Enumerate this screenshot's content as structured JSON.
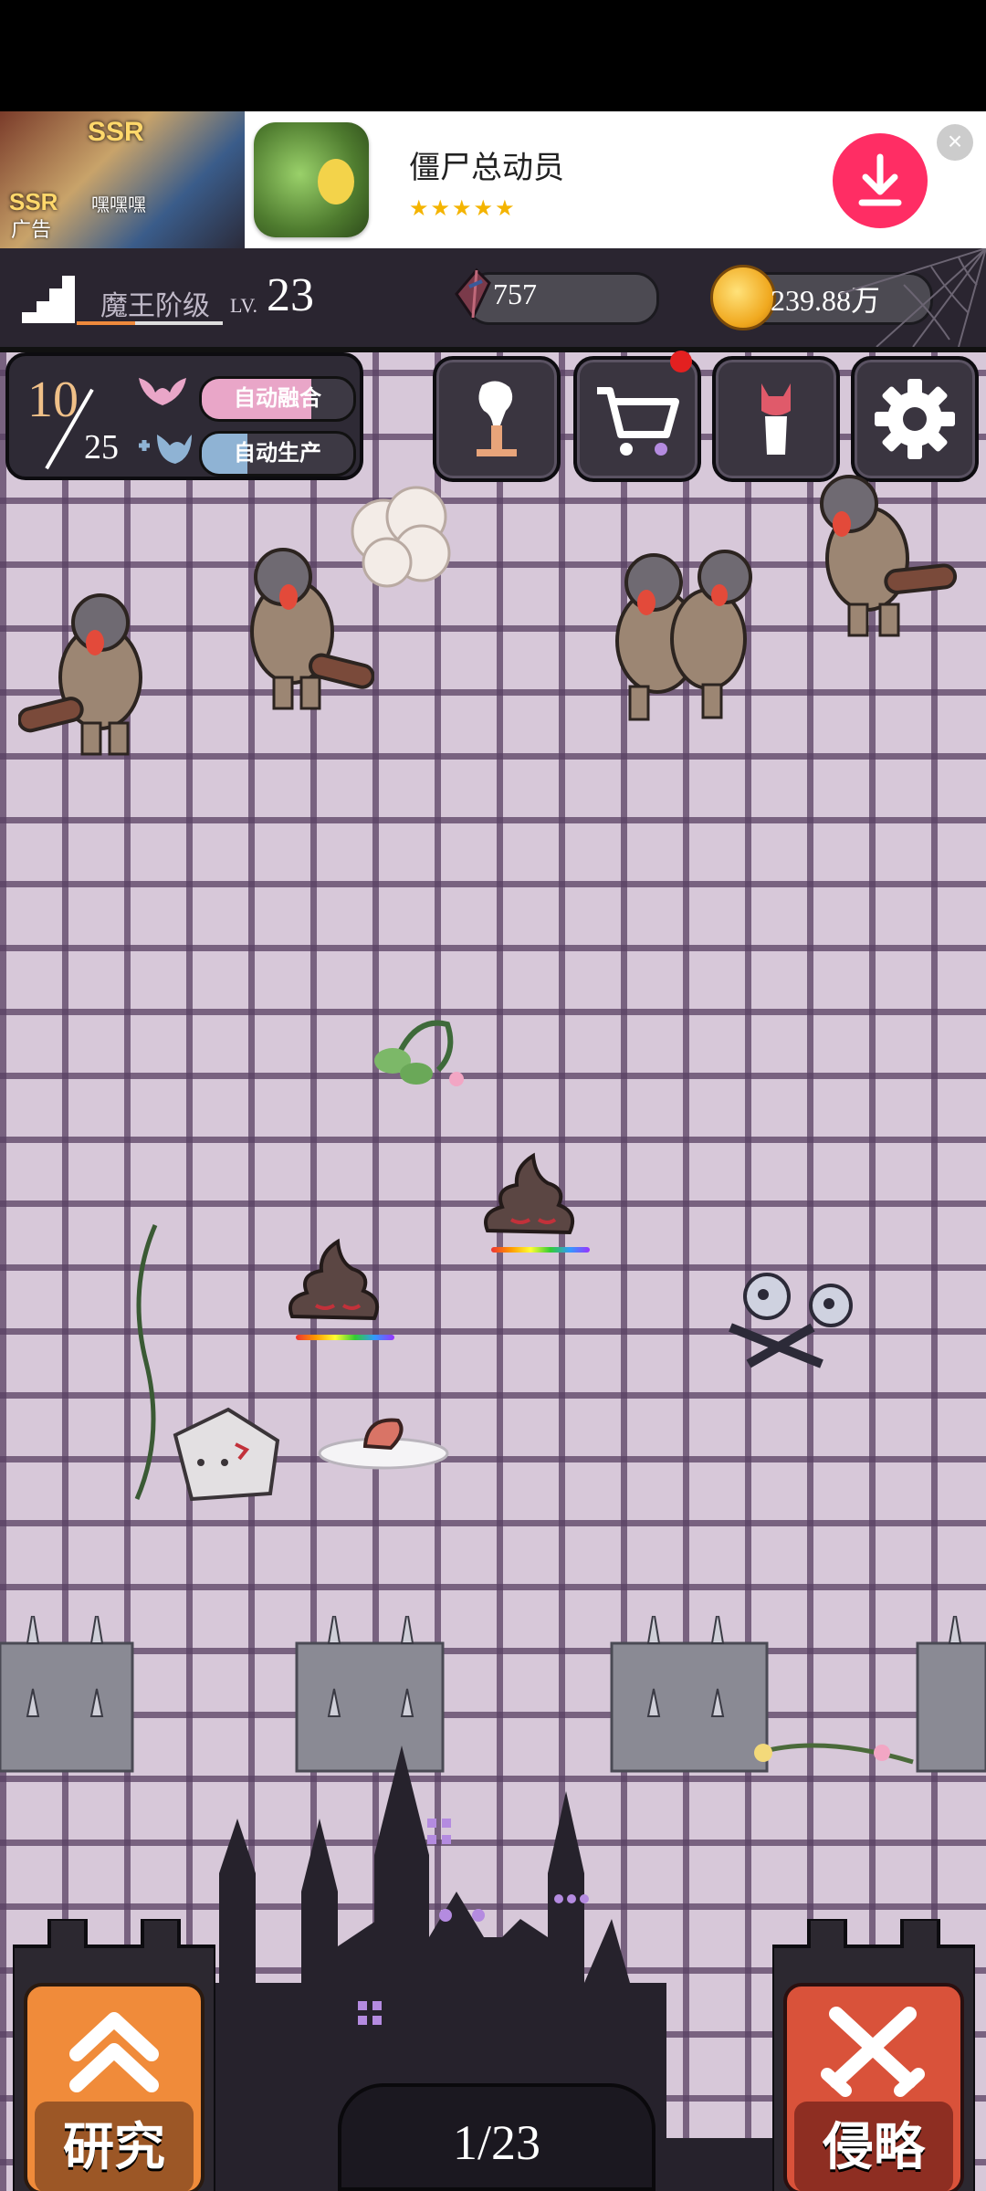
{
  "ad": {
    "thumb_badge_1": "SSR",
    "thumb_badge_2": "SSR",
    "thumb_caption": "嘿嘿嘿",
    "tag": "广告",
    "app_title": "僵尸总动员",
    "rating_stars": "★★★★★"
  },
  "hud": {
    "rank_label": "魔王阶级",
    "lv_label": "LV.",
    "lv_value": "23",
    "gems": "757",
    "coins": "239.88万"
  },
  "spawn": {
    "current": "10",
    "max": "25",
    "auto_merge_label": "自动融合",
    "auto_merge_progress": 0.72,
    "auto_produce_label": "自动生产",
    "auto_produce_progress": 0.3
  },
  "menu": {
    "has_notification_shop": true
  },
  "bottom": {
    "research_label": "研究",
    "invade_label": "侵略",
    "page_indicator": "1/23"
  },
  "colors": {
    "accent_research": "#f08b3a",
    "accent_invade": "#d9523a",
    "download_button": "#ff2d64"
  }
}
